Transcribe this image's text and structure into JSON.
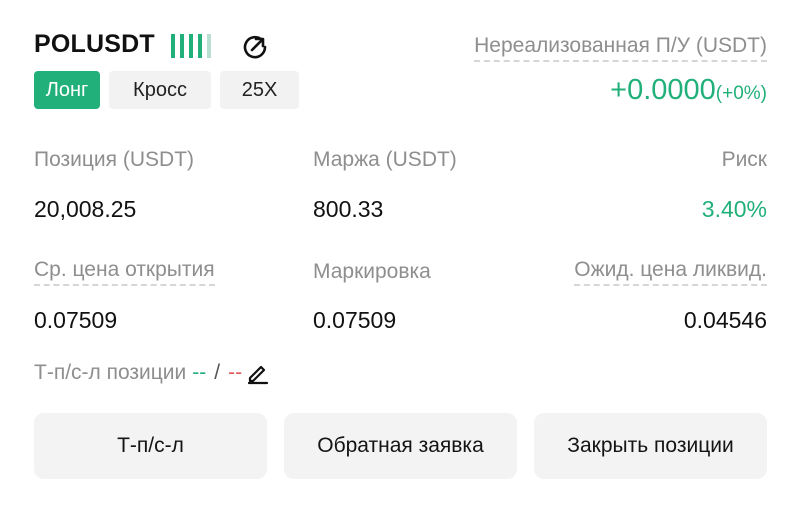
{
  "header": {
    "symbol": "POLUSDT",
    "pnl_label": "Нереализованная П/У (USDT)",
    "pnl_value": "+0.0000",
    "pnl_pct": "(+0%)"
  },
  "tags": {
    "side": "Лонг",
    "margin_mode": "Кросс",
    "leverage": "25X"
  },
  "stats": {
    "position_label": "Позиция (USDT)",
    "position_value": "20,008.25",
    "margin_label": "Маржа (USDT)",
    "margin_value": "800.33",
    "risk_label": "Риск",
    "risk_value": "3.40%",
    "entry_label": "Ср. цена открытия",
    "entry_value": "0.07509",
    "mark_label": "Маркировка",
    "mark_value": "0.07509",
    "liq_label": "Ожид. цена ликвид.",
    "liq_value": "0.04546"
  },
  "tpsl": {
    "label": "Т-п/с-л позиции",
    "tp_value": "--",
    "separator": "/",
    "sl_value": "--"
  },
  "actions": {
    "tpsl_button": "Т-п/с-л",
    "reverse_button": "Обратная заявка",
    "close_button": "Закрыть позиции"
  },
  "colors": {
    "accent_green": "#21b07a",
    "loss_red": "#e05a5a",
    "pill_bg": "#f2f2f2"
  },
  "icons": [
    "signal-bars-icon",
    "share-icon",
    "edit-icon"
  ]
}
